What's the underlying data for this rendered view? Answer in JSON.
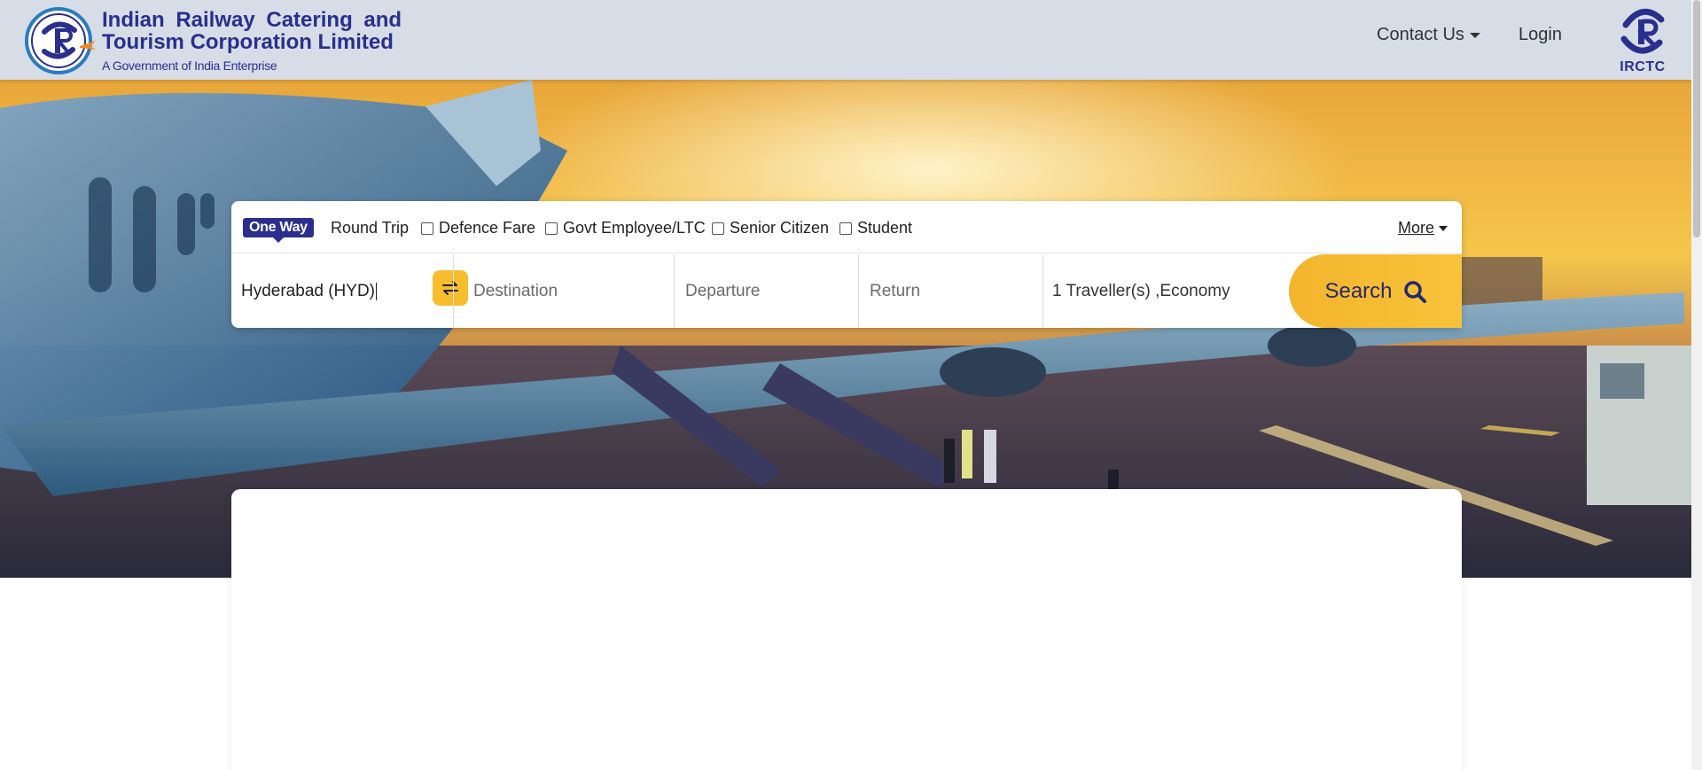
{
  "header": {
    "org_name_line1": "Indian Railway Catering and",
    "org_name_line2": "Tourism Corporation Limited",
    "org_subtitle": "A Government of India Enterprise",
    "nav": {
      "contact_label": "Contact Us",
      "login_label": "Login"
    },
    "brand_mark_label": "IRCTC"
  },
  "search": {
    "trip_types": {
      "one_way": "One Way",
      "round_trip": "Round Trip"
    },
    "fare_options": [
      {
        "label": "Defence Fare",
        "checked": false
      },
      {
        "label": "Govt Employee/LTC",
        "checked": false
      },
      {
        "label": "Senior Citizen",
        "checked": false
      },
      {
        "label": "Student",
        "checked": false
      }
    ],
    "more_label": "More",
    "origin_value": "Hyderabad (HYD)",
    "destination_placeholder": "Destination",
    "departure_placeholder": "Departure",
    "return_placeholder": "Return",
    "traveller_value": "1 Traveller(s) ,Economy",
    "search_label": "Search"
  },
  "colors": {
    "brand_navy": "#2a2f8d",
    "accent_yellow": "#f6bd2d",
    "header_bg": "#d6dde7"
  },
  "icons": [
    "swap-icon",
    "search-icon",
    "chevron-down-icon",
    "irctc-logo-icon"
  ]
}
